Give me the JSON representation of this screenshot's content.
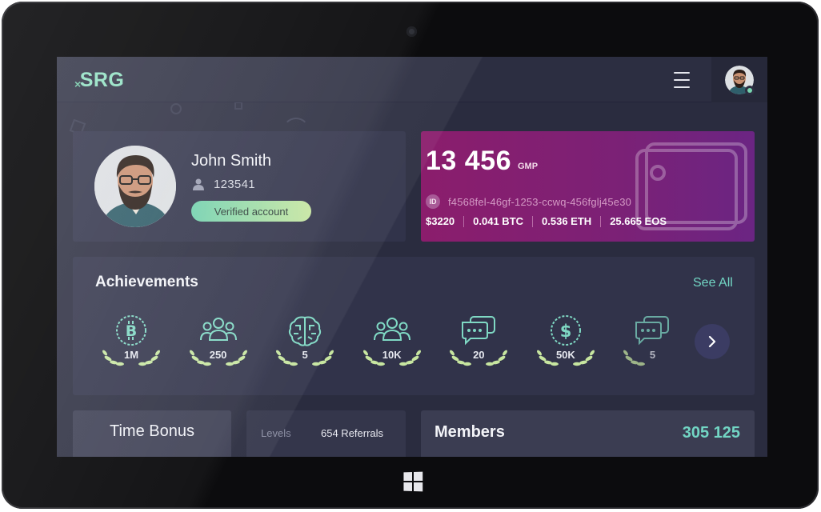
{
  "app": {
    "logo_text": "SRG",
    "logo_mark": "×"
  },
  "header": {
    "menu_icon": "hamburger-menu-icon",
    "avatar_icon": "user-avatar"
  },
  "profile": {
    "name": "John Smith",
    "user_id": "123541",
    "status": "Verified account"
  },
  "wallet": {
    "balance": "13 456",
    "currency": "GMP",
    "id_label": "ID",
    "wallet_id": "f4568fel-46gf-1253-ccwq-456fglj45e30",
    "rates": [
      "$3220",
      "0.041 BTC",
      "0.536 ETH",
      "25.665 EOS"
    ]
  },
  "achievements": {
    "title": "Achievements",
    "see_all": "See All",
    "badges": [
      {
        "icon": "bitcoin-icon",
        "count": "1M"
      },
      {
        "icon": "users-group-icon",
        "count": "250"
      },
      {
        "icon": "brain-icon",
        "count": "5"
      },
      {
        "icon": "users-group-icon",
        "count": "10K"
      },
      {
        "icon": "chat-bubbles-icon",
        "count": "20"
      },
      {
        "icon": "dollar-icon",
        "count": "50K"
      },
      {
        "icon": "chat-bubbles-icon",
        "count": "5"
      }
    ]
  },
  "cards": {
    "time_bonus": "Time Bonus",
    "levels": "Levels",
    "referrals": "654 Referrals",
    "members_title": "Members",
    "members_count": "305 125"
  },
  "colors": {
    "accent": "#72d6c4",
    "wallet_gradient_start": "#8b1d6c",
    "wallet_gradient_end": "#6b2583",
    "card_bg": "#31334a",
    "screen_bg": "#2a2c3f"
  }
}
